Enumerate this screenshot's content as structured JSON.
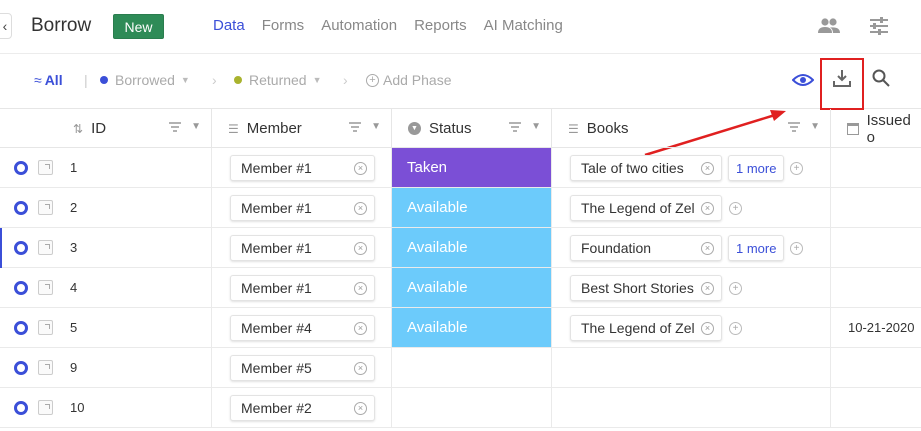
{
  "app": {
    "back_symbol": "‹",
    "title": "Borrow",
    "new_label": "New"
  },
  "nav": [
    "Data",
    "Forms",
    "Automation",
    "Reports",
    "AI Matching"
  ],
  "phases": {
    "all_label": "All",
    "all_glyph": "≈",
    "items": [
      {
        "label": "Borrowed",
        "color": "#3b4fd8"
      },
      {
        "label": "Returned",
        "color": "#a9b32e"
      }
    ],
    "add_label": "Add Phase"
  },
  "columns": {
    "id": "ID",
    "member": "Member",
    "status": "Status",
    "books": "Books",
    "issued": "Issued o"
  },
  "colors": {
    "taken": "#7b4fd6",
    "available": "#6ccbfb",
    "accent": "#3b4fd8",
    "highlight": "#e02020"
  },
  "rows": [
    {
      "id": "1",
      "member": "Member #1",
      "status": "Taken",
      "book": "Tale of two cities",
      "more": "1 more",
      "issued": ""
    },
    {
      "id": "2",
      "member": "Member #1",
      "status": "Available",
      "book": "The Legend of Zel",
      "more": "",
      "issued": ""
    },
    {
      "id": "3",
      "member": "Member #1",
      "status": "Available",
      "book": "Foundation",
      "more": "1 more",
      "issued": ""
    },
    {
      "id": "4",
      "member": "Member #1",
      "status": "Available",
      "book": "Best Short Stories",
      "more": "",
      "issued": ""
    },
    {
      "id": "5",
      "member": "Member #4",
      "status": "Available",
      "book": "The Legend of Zel",
      "more": "",
      "issued": "10-21-2020"
    },
    {
      "id": "9",
      "member": "Member #5",
      "status": "",
      "book": "",
      "more": "",
      "issued": ""
    },
    {
      "id": "10",
      "member": "Member #2",
      "status": "",
      "book": "",
      "more": "",
      "issued": ""
    }
  ],
  "icons": [
    "back-icon",
    "members-icon",
    "settings-sliders-icon",
    "eye-icon",
    "download-icon",
    "search-icon"
  ]
}
